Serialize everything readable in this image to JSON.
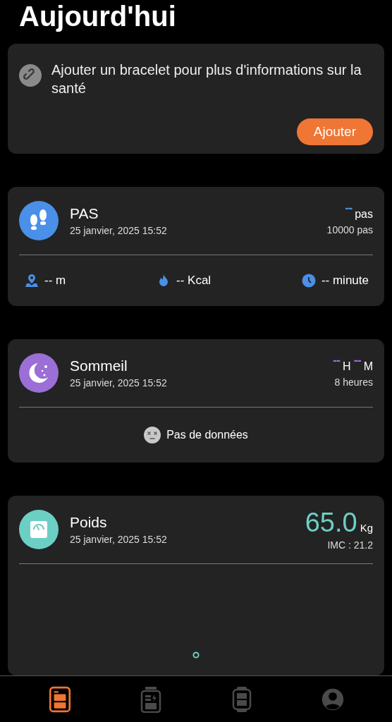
{
  "title": "Aujourd'hui",
  "promo": {
    "text": "Ajouter un bracelet pour plus d'informations sur la santé",
    "button": "Ajouter"
  },
  "cards": [
    {
      "kind": "steps",
      "title": "PAS",
      "date": "25 janvier, 2025 15:52",
      "value": "--",
      "unit": "pas",
      "goal": "10000 pas",
      "stats": [
        {
          "kind": "distance",
          "text": "-- m"
        },
        {
          "kind": "calories",
          "text": "-- Kcal"
        },
        {
          "kind": "duration",
          "text": "-- minute"
        }
      ]
    },
    {
      "kind": "sleep",
      "title": "Sommeil",
      "date": "25 janvier, 2025 15:52",
      "hours": "--",
      "hours_unit": "H",
      "minutes": "--",
      "minutes_unit": "M",
      "goal": "8 heures",
      "empty_text": "Pas de données"
    },
    {
      "kind": "weight",
      "title": "Poids",
      "date": "25 janvier, 2025 15:52",
      "value": "65.0",
      "unit": "Kg",
      "bmi": "IMC : 21.2"
    }
  ],
  "nav": [
    {
      "kind": "today",
      "selected": true
    },
    {
      "kind": "activity",
      "selected": false
    },
    {
      "kind": "device",
      "selected": false
    },
    {
      "kind": "profile",
      "selected": false
    }
  ]
}
